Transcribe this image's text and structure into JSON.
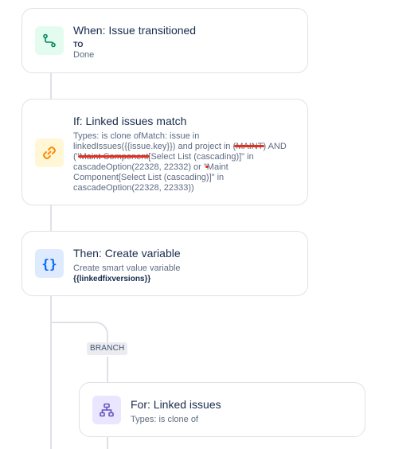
{
  "trigger": {
    "title": "When: Issue transitioned",
    "to_label": "TO",
    "status": "Done"
  },
  "condition": {
    "title": "If: Linked issues match",
    "line1": "Types: is clone ofMatch: issue in linkedIssues({{issue.key}}) and project in (",
    "redact1": "MAINT",
    "line2": ") AND (\"",
    "redact2": "Maint Component",
    "line3": "[Select List (cascading)]\" in cascadeOption(22328, 22332) or \"",
    "redact3": "Maint Component",
    "line4": "[Select List (cascading)]\" in cascadeOption(22328, 22333))"
  },
  "action": {
    "title": "Then: Create variable",
    "description": "Create smart value variable",
    "variable": "{{linkedfixversions}}"
  },
  "branch": {
    "tag": "BRANCH",
    "title": "For: Linked issues",
    "description": "Types: is clone of"
  },
  "colors": {
    "trigger_icon_bg": "#e3fcef",
    "trigger_icon": "#00875a",
    "condition_icon_bg": "#fff7d6",
    "condition_icon": "#ff8b00",
    "action_icon_bg": "#deebff",
    "action_icon": "#0065ff",
    "branch_icon_bg": "#eae6ff",
    "branch_icon": "#6554c0",
    "redaction": "#e82d1a"
  },
  "icons": {
    "trigger": "transition-icon",
    "condition": "link-icon",
    "action": "braces-icon",
    "branch": "hierarchy-icon"
  }
}
